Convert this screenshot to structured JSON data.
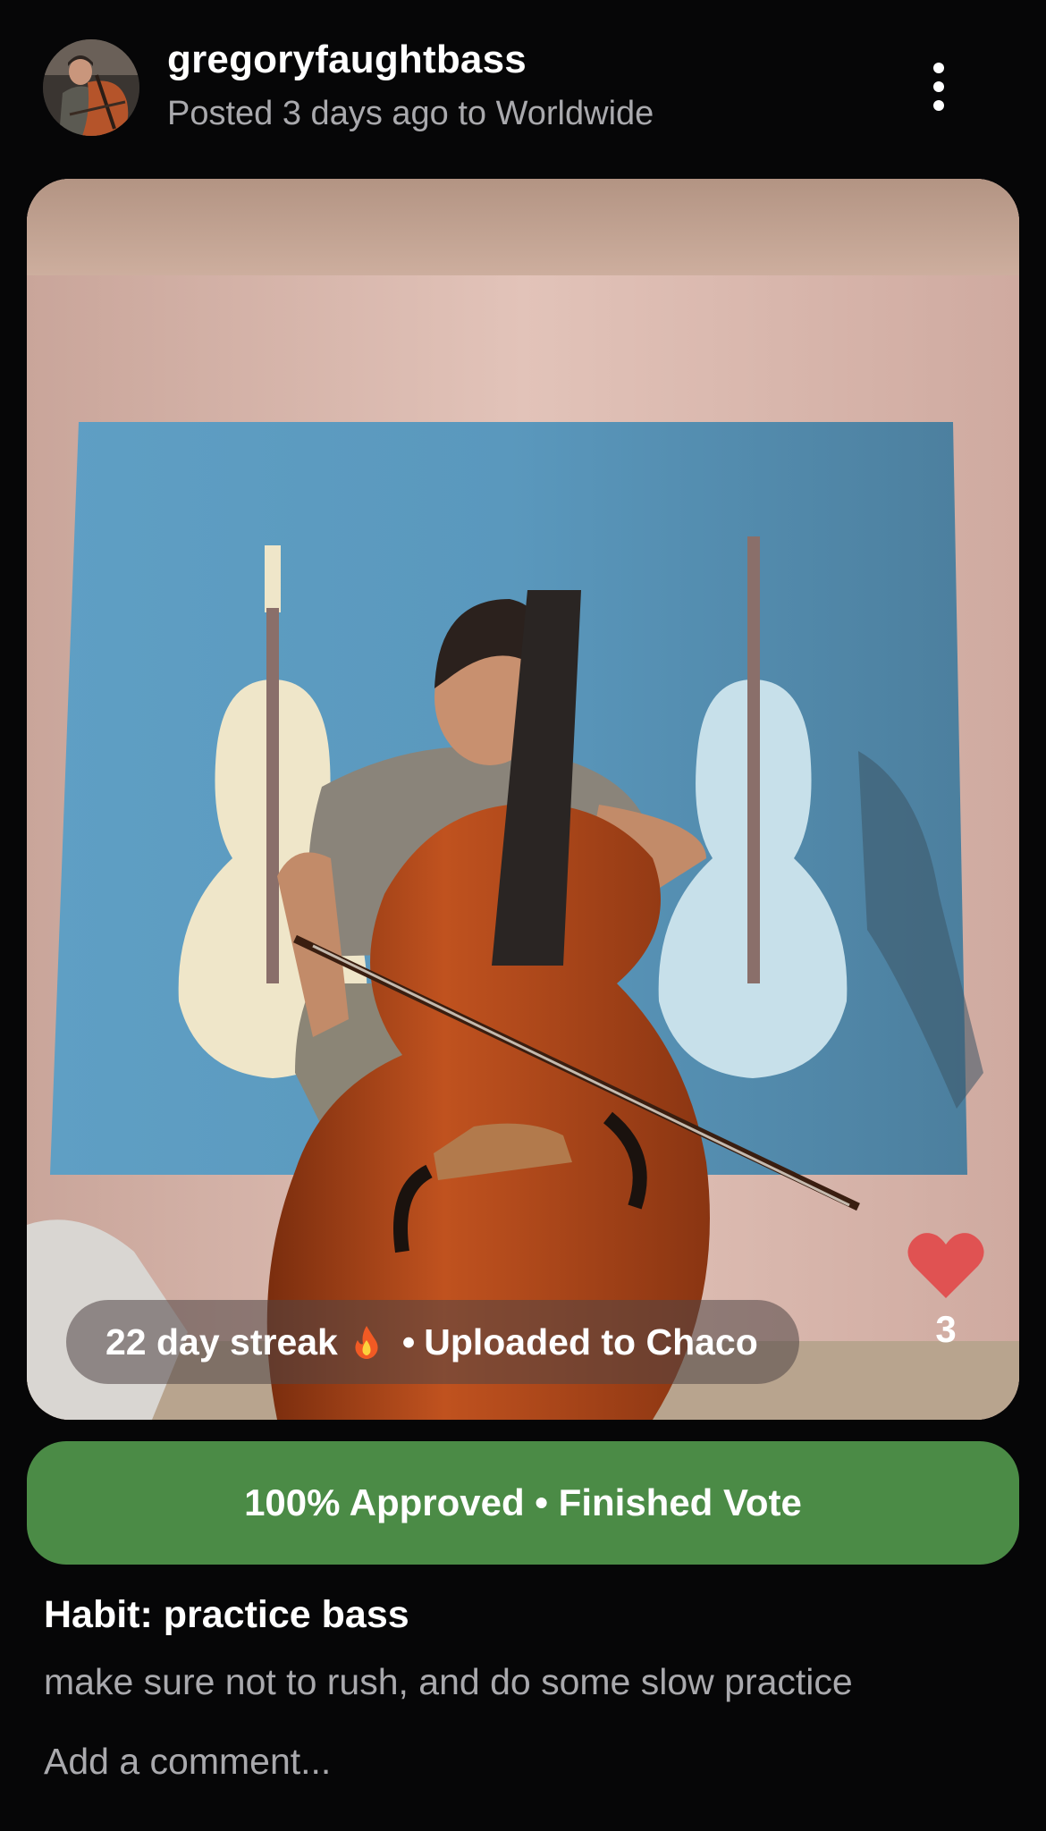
{
  "post": {
    "username": "gregoryfaughtbass",
    "meta": "Posted 3 days ago to Worldwide",
    "avatar_icon": "user-avatar-photo",
    "menu_icon": "more-vertical-icon"
  },
  "media": {
    "streak_text": "22 day streak",
    "streak_icon": "fire-emoji",
    "separator": "•",
    "upload_text": "Uploaded to Chaco",
    "like_icon": "heart-icon",
    "like_color": "#e05252",
    "like_count": "3"
  },
  "approval": {
    "text": "100% Approved • Finished Vote",
    "color": "#4b8b46"
  },
  "habit": {
    "title": "Habit: practice bass",
    "note": "make sure not to rush, and do some slow practice"
  },
  "comment": {
    "placeholder": "Add a comment..."
  }
}
